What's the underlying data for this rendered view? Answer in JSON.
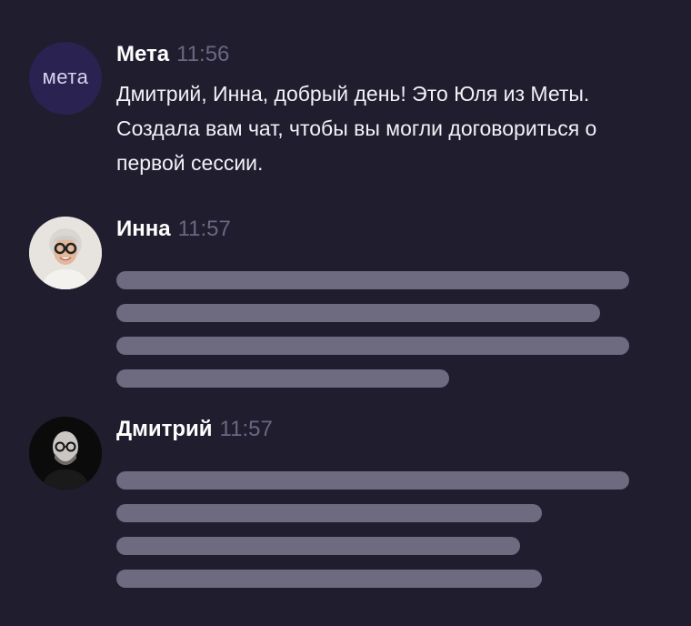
{
  "messages": [
    {
      "author": "Мета",
      "time": "11:56",
      "avatar_text": "мета",
      "text": "Дмитрий, Инна, добрый день! Это Юля из Меты. Создала вам чат, чтобы вы могли договориться о первой сессии."
    },
    {
      "author": "Инна",
      "time": "11:57",
      "avatar": "user-avatar-inna"
    },
    {
      "author": "Дмитрий",
      "time": "11:57",
      "avatar": "user-avatar-dmitry"
    }
  ],
  "colors": {
    "background": "#1f1d2e",
    "skeleton": "#6e6b81",
    "timestamp": "#6a6782",
    "meta_avatar": "#2a2250"
  }
}
